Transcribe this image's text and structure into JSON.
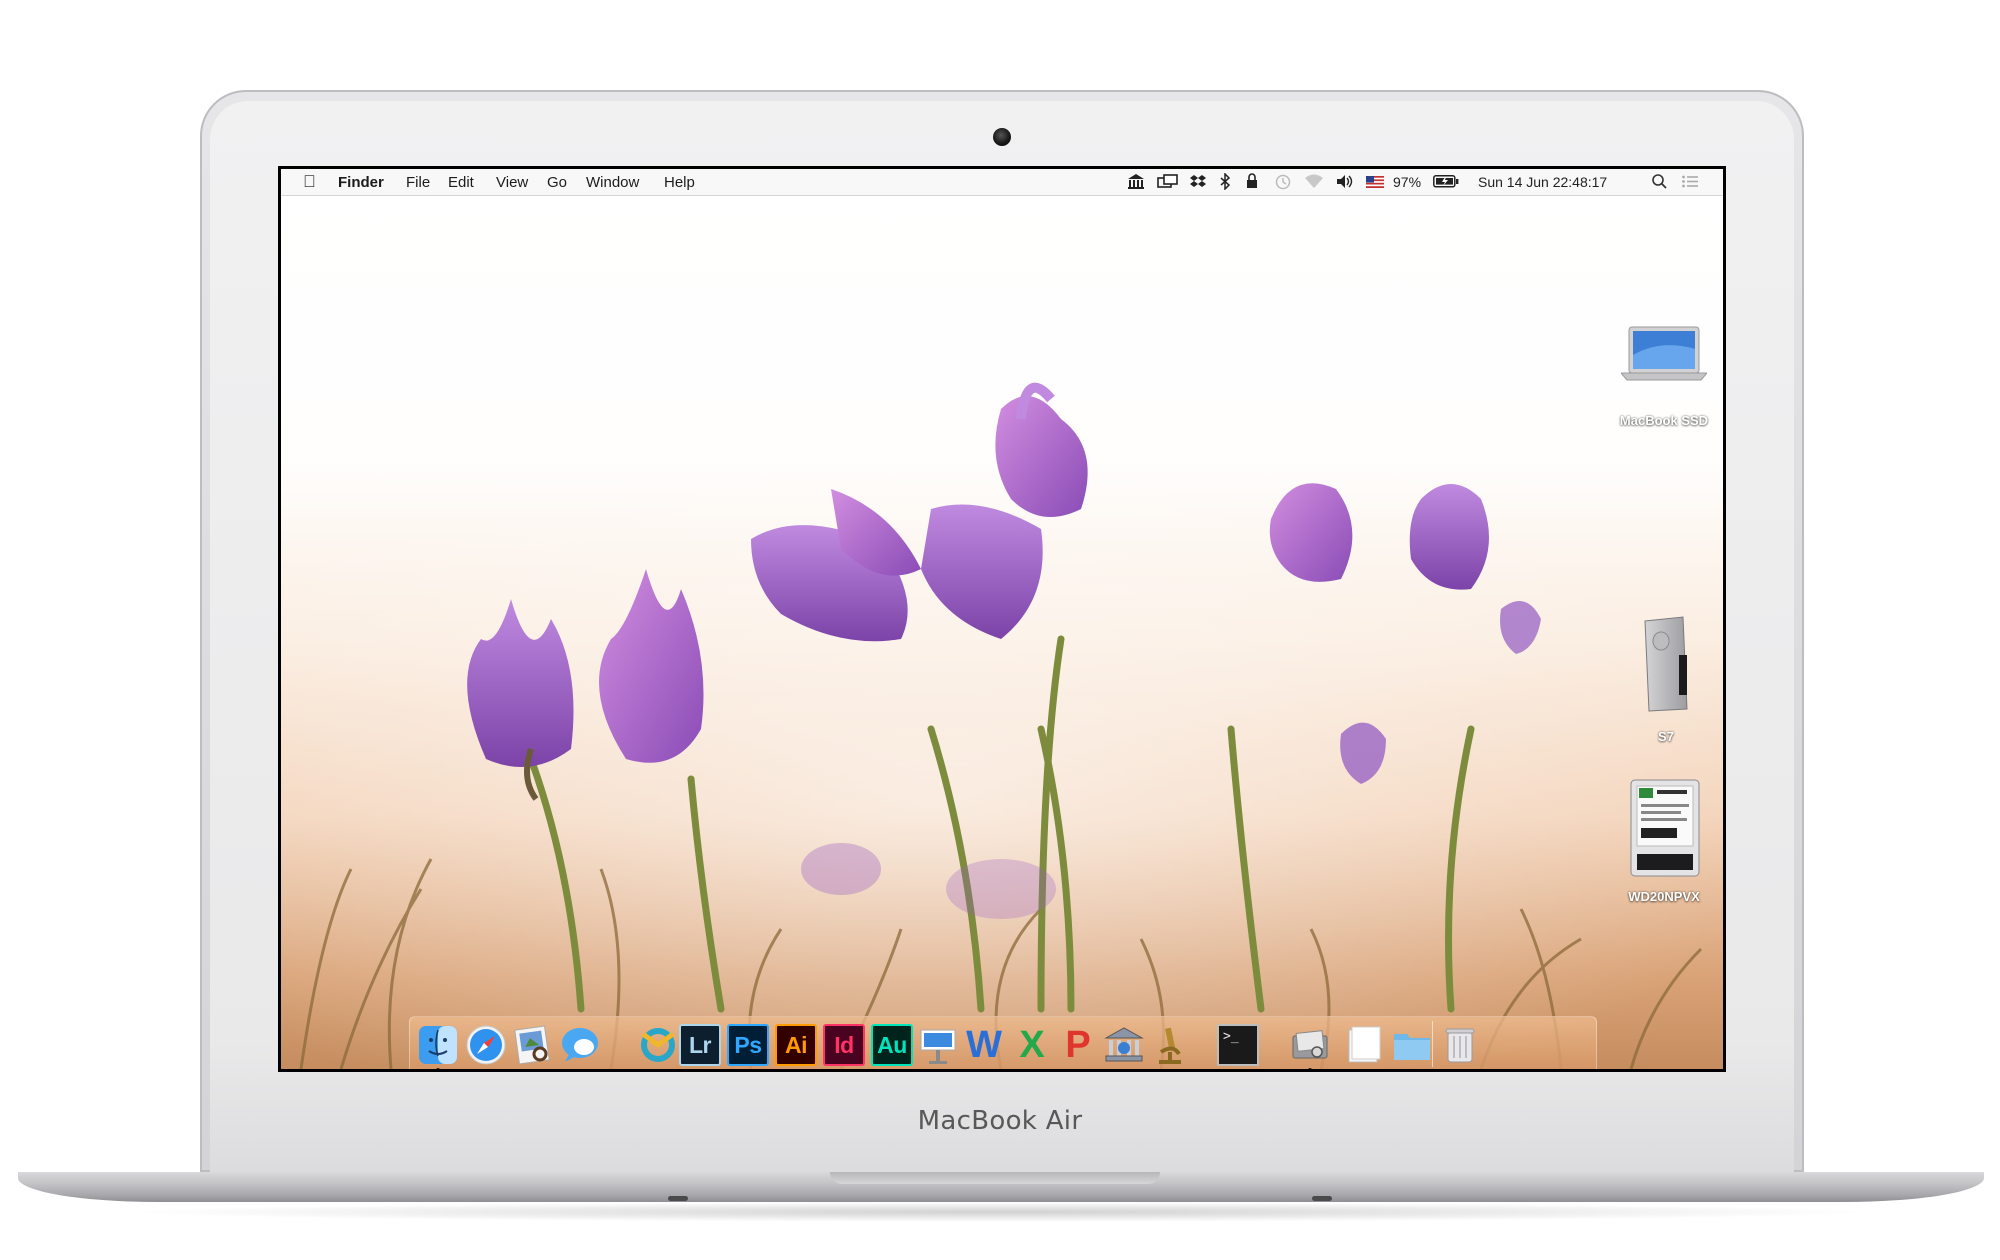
{
  "device": {
    "brand_label": "MacBook Air"
  },
  "menubar": {
    "apple_icon": "apple-icon",
    "app_name": "Finder",
    "menus": [
      "File",
      "Edit",
      "View",
      "Go",
      "Window",
      "Help"
    ],
    "battery_percent": "97%",
    "datetime": "Sun 14 Jun  22:48:17",
    "status_icons": [
      "bank-icon",
      "screen-share-icon",
      "dropbox-icon",
      "bluetooth-icon",
      "lock-icon",
      "time-machine-icon",
      "wifi-icon",
      "volume-icon",
      "us-flag-icon",
      "battery-icon",
      "spotlight-icon",
      "notification-center-icon"
    ]
  },
  "desktop": {
    "icons": [
      {
        "label": "MacBook SSD",
        "icon": "laptop-drive-icon"
      },
      {
        "label": "S7",
        "icon": "external-drive-icon"
      },
      {
        "label": "WD20NPVX",
        "icon": "hard-disk-icon"
      }
    ]
  },
  "dock": {
    "apps": [
      {
        "name": "Finder",
        "icon": "finder-icon",
        "running": true
      },
      {
        "name": "Safari",
        "icon": "safari-icon",
        "running": false
      },
      {
        "name": "Preview",
        "icon": "preview-icon",
        "running": false
      },
      {
        "name": "Messages",
        "icon": "messages-icon",
        "running": false
      },
      {
        "name": "Dreamweaver",
        "icon": "dreamweaver-icon",
        "running": false
      },
      {
        "name": "Lightroom",
        "label": "Lr",
        "running": false
      },
      {
        "name": "Photoshop",
        "label": "Ps",
        "running": false
      },
      {
        "name": "Illustrator",
        "label": "Ai",
        "running": false
      },
      {
        "name": "InDesign",
        "label": "Id",
        "running": false
      },
      {
        "name": "Audition",
        "label": "Au",
        "running": false
      },
      {
        "name": "Keynote",
        "icon": "keynote-icon",
        "running": false
      },
      {
        "name": "Word",
        "label": "W",
        "running": false
      },
      {
        "name": "Excel",
        "label": "X",
        "running": false
      },
      {
        "name": "PowerPoint",
        "label": "P",
        "running": false
      },
      {
        "name": "Mac App",
        "icon": "library-icon",
        "running": false
      },
      {
        "name": "Instruments",
        "icon": "microscope-icon",
        "running": false
      },
      {
        "name": "Terminal",
        "label": ">_",
        "running": false
      },
      {
        "name": "Image Capture",
        "icon": "image-capture-icon",
        "running": true
      },
      {
        "name": "Documents",
        "icon": "documents-stack-icon",
        "running": false
      },
      {
        "name": "Folder",
        "icon": "folder-icon",
        "running": false
      },
      {
        "name": "Trash",
        "icon": "trash-icon",
        "running": false
      }
    ]
  },
  "colors": {
    "menubar_bg": "#f8f8f8",
    "flower": "#9a5fc4",
    "photoshop": "#31a8ff",
    "illustrator": "#ff9a00",
    "indesign": "#ff3366",
    "audition": "#00e4bb",
    "lightroom": "#add5ec"
  }
}
